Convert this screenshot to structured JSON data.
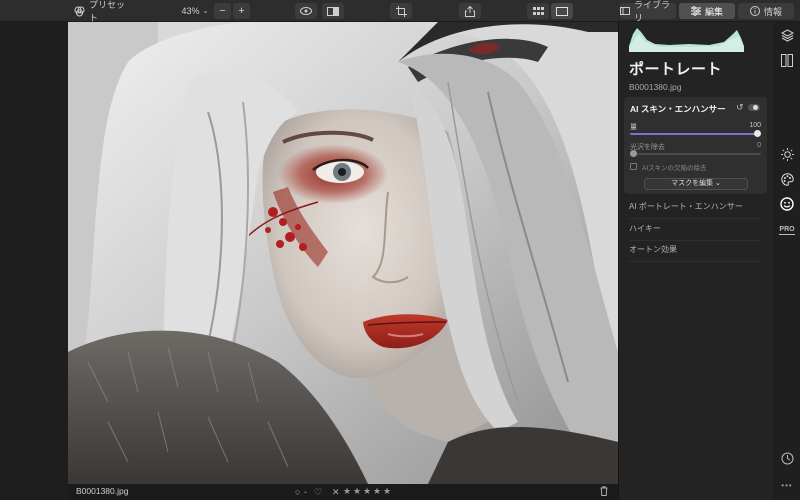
{
  "toolbar": {
    "preset_label": "プリセット",
    "zoom_label": "43%",
    "library_label": "ライブラリ",
    "edit_label": "編集",
    "info_label": "情報"
  },
  "panel": {
    "title": "ポートレート",
    "filename": "B0001380.jpg",
    "ai_skin": {
      "title": "AI スキン・エンハンサー",
      "amount_label": "量",
      "amount_value": "100",
      "amount_fraction": 1.0,
      "shine_label": "光沢を除去",
      "shine_value": "0",
      "shine_fraction": 0.0,
      "checkbox_label": "AIスキンの欠陥の除去",
      "mask_button_label": "マスクを編集 ⌄"
    },
    "tools": [
      {
        "label": "AI ポートレート・エンハンサー"
      },
      {
        "label": "ハイキー"
      },
      {
        "label": "オートン効果"
      }
    ]
  },
  "statusbar": {
    "filename": "B0001380.jpg",
    "rating_stars": [
      "★",
      "★",
      "★",
      "★",
      "★"
    ]
  },
  "rail": {
    "icons": [
      "layers-icon",
      "compare-icon",
      "sun-icon",
      "palette-icon",
      "face-icon",
      "pro-icon",
      "history-icon",
      "more-icon"
    ],
    "pro_label": "PRO",
    "more_label": "•••"
  },
  "colors": {
    "accent": "#7c6fd6",
    "panel_bg": "#232323",
    "toolbar_bg": "#2d2d2d"
  }
}
